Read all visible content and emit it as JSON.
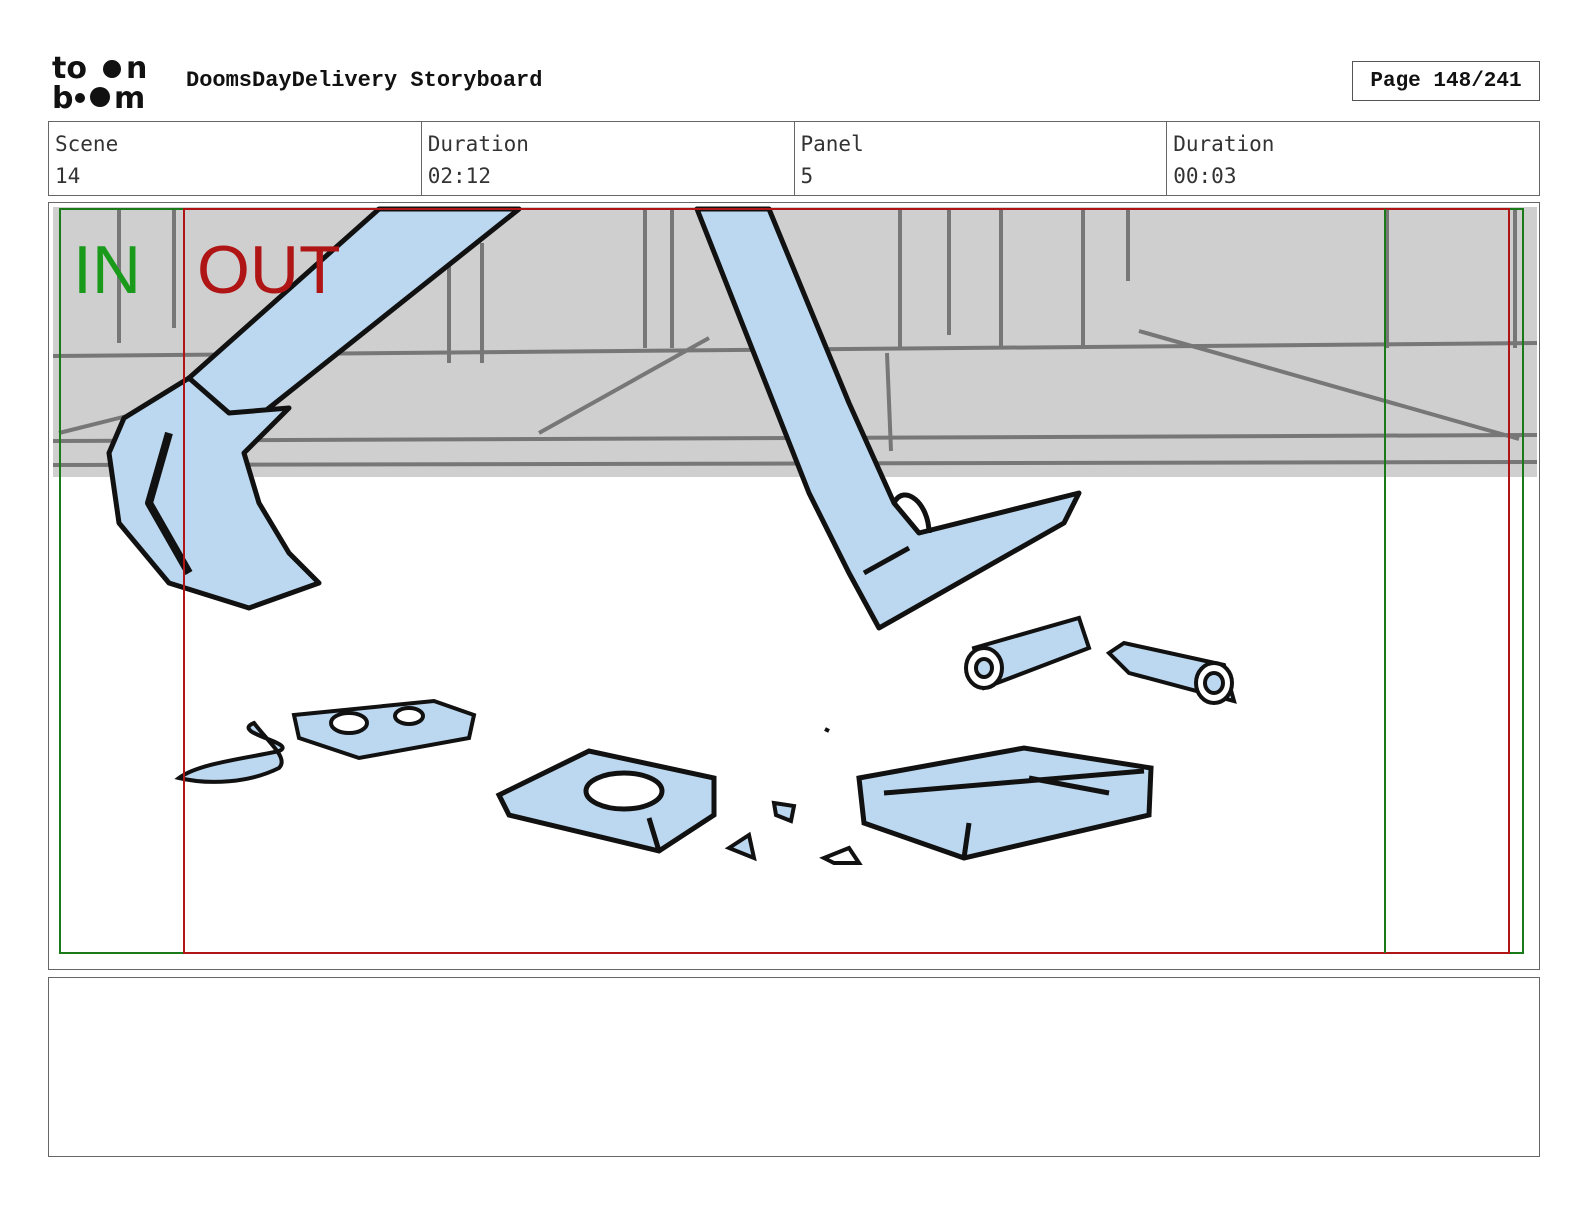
{
  "header": {
    "logo_top": "to",
    "logo_bottom": "b",
    "logo_n": "n",
    "logo_m": "m",
    "title": "DoomsDayDelivery Storyboard",
    "page": "Page 148/241"
  },
  "info": {
    "scene_label": "Scene",
    "scene_value": "14",
    "scene_duration_label": "Duration",
    "scene_duration_value": "02:12",
    "panel_label": "Panel",
    "panel_value": "5",
    "panel_duration_label": "Duration",
    "panel_duration_value": "00:03"
  },
  "frame": {
    "in_label": "IN",
    "out_label": "OUT",
    "in_color": "#1a9a1a",
    "out_color": "#b01515"
  },
  "notes": {
    "text": ""
  }
}
